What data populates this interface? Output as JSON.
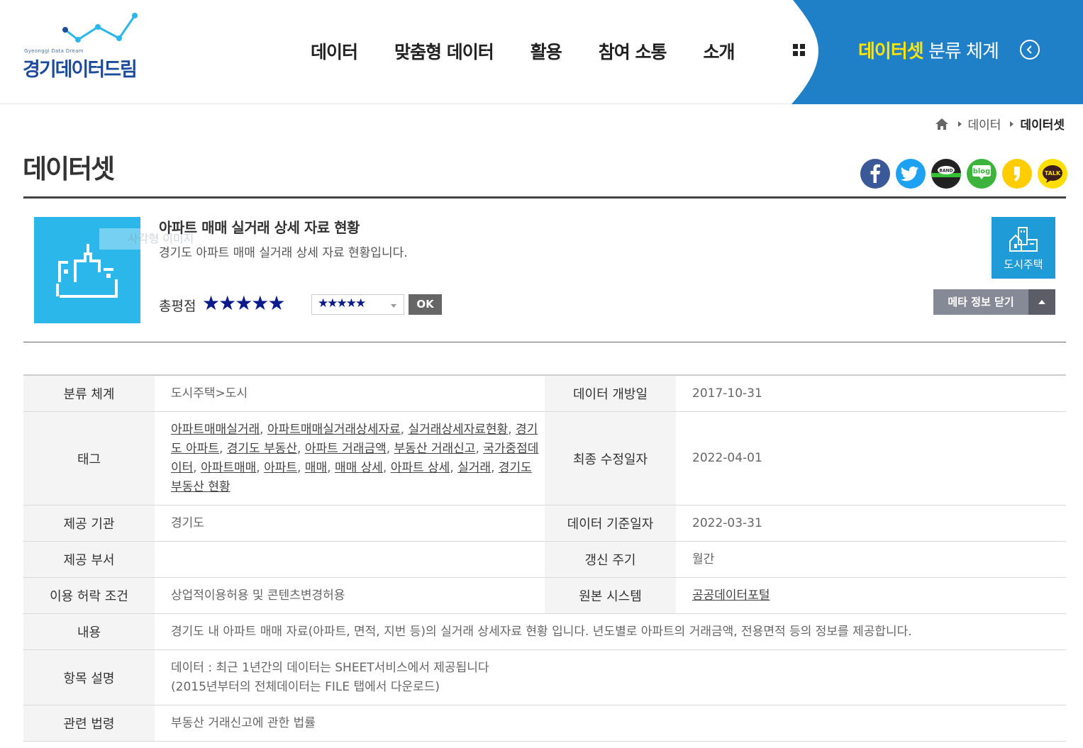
{
  "header": {
    "logo_sub": "Gyeonggi Data Dream",
    "logo_text": "경기데이터드림",
    "nav": [
      "데이터",
      "맞춤형 데이터",
      "활용",
      "참여 소통",
      "소개"
    ],
    "panel_highlight": "데이터셋",
    "panel_rest": " 분류 체계"
  },
  "breadcrumb": {
    "level1": "데이터",
    "current": "데이터셋"
  },
  "page_title": "데이터셋",
  "share": [
    {
      "name": "facebook-icon",
      "label": "f",
      "color": "#3b5998"
    },
    {
      "name": "twitter-icon",
      "label": "",
      "color": "#1da1f2"
    },
    {
      "name": "band-icon",
      "label": "BAND",
      "color": "#222222"
    },
    {
      "name": "blog-icon",
      "label": "blog",
      "color": "#3cb43c"
    },
    {
      "name": "kakaostory-icon",
      "label": "",
      "color": "#ffcd00"
    },
    {
      "name": "kakaotalk-icon",
      "label": "TALK",
      "color": "#ffde00"
    }
  ],
  "dataset": {
    "thumb_ghost": "사각형 이미지",
    "title": "아파트 매매 실거래 상세 자료 현황",
    "description": "경기도 아파트 매매 실거래 상세 자료 현황입니다.",
    "rating_label": "총평점",
    "rating_stars": "★★★★★",
    "rating_value": 5,
    "rating_select": "★★★★★",
    "ok_label": "OK",
    "category_badge": "도시주택",
    "meta_toggle": "메타 정보 닫기"
  },
  "meta": {
    "classification_label": "분류 체계",
    "classification": "도시주택>도시",
    "open_date_label": "데이터 개방일",
    "open_date": "2017-10-31",
    "tags_label": "태그",
    "tags": [
      "아파트매매실거래",
      "아파트매매실거래상세자료",
      "실거래상세자료현황",
      "경기도 아파트",
      "경기도 부동산",
      "아파트 거래금액",
      "부동산 거래신고",
      "국가중점데이터",
      "아파트매매",
      "아파트",
      "매매",
      "매매 상세",
      "아파트 상세",
      "실거래",
      "경기도 부동산 현황"
    ],
    "modified_label": "최종 수정일자",
    "modified": "2022-04-01",
    "provider_label": "제공 기관",
    "provider": "경기도",
    "base_date_label": "데이터 기준일자",
    "base_date": "2022-03-31",
    "department_label": "제공 부서",
    "department": "",
    "cycle_label": "갱신 주기",
    "cycle": "월간",
    "license_label": "이용 허락 조건",
    "license": "상업적이용허용 및 콘텐츠변경허용",
    "source_label": "원본 시스템",
    "source": "공공데이터포털",
    "content_label": "내용",
    "content": "경기도 내 아파트 매매 자료(아파트, 면적, 지번 등)의 실거래 상세자료 현황 입니다. 년도별로 아파트의 거래금액, 전용면적 등의 정보를 제공합니다.",
    "items_label": "항목 설명",
    "items_line1": "데이터 : 최근 1년간의 데이터는 SHEET서비스에서 제공됩니다",
    "items_line2": "(2015년부터의 전체데이터는 FILE 탭에서 다운로드)",
    "law_label": "관련 법령",
    "law": "부동산 거래신고에 관한 법률"
  }
}
